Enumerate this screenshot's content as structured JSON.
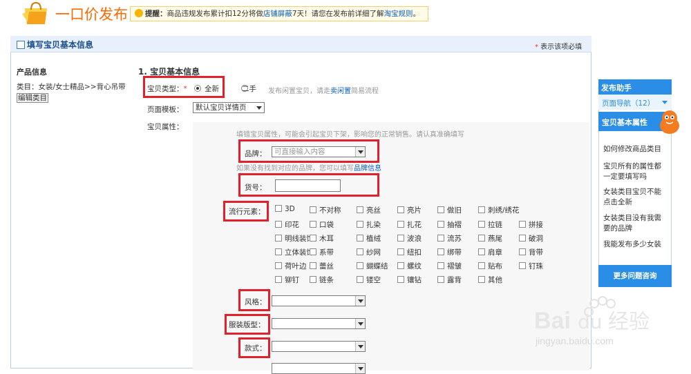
{
  "header": {
    "title": "一口价发布",
    "notice_label": "提醒：",
    "notice_text_1": "商品违规发布累计扣12分将做",
    "notice_link_1": "店铺屏蔽",
    "notice_text_2": "7天！请您在发布前详细了解",
    "notice_link_2": "淘宝规则",
    "notice_end": "。"
  },
  "panel": {
    "title": "填写宝贝基本信息",
    "required_star": "*",
    "required_note": " 表示该项必填"
  },
  "left": {
    "heading": "产品信息",
    "category": "类目：女装/女士精品>>背心吊带",
    "edit_button": "编辑类目"
  },
  "form": {
    "section_heading": "1. 宝贝基本信息",
    "type_label": "宝贝类型：",
    "type_star": "*",
    "type_option_new": "全新",
    "type_option_used": "二手",
    "type_hint": "发布闲置宝贝，请走",
    "type_hint_link": "卖闲置",
    "type_hint_end": "简易流程",
    "template_label": "页面模板：",
    "template_value": "默认宝贝详情页",
    "props_label": "宝贝属性：",
    "props_hint": "填错宝贝属性，可能会引起宝贝下架，影响您的正常销售。请认真准确填写",
    "brand_label": "品牌：",
    "brand_placeholder": "可直接输入内容",
    "brand_hint": "如果没有找到对应的品牌，您可以填写",
    "brand_hint_link": "品牌信息",
    "model_label": "货号：",
    "elements_label": "流行元素：",
    "elements": [
      [
        "3D",
        "不对称",
        "亮丝",
        "亮片",
        "做旧",
        "刺绣/绣花"
      ],
      [
        "印花",
        "口袋",
        "扎染",
        "扎花",
        "抽褶",
        "拉链",
        "拼接"
      ],
      [
        "明线装饰",
        "木耳",
        "植绒",
        "波浪",
        "流苏",
        "燕尾",
        "破洞"
      ],
      [
        "立体装饰",
        "系带",
        "纱网",
        "纽扣",
        "绑带",
        "肩章",
        "背带"
      ],
      [
        "荷叶边",
        "蕾丝",
        "蝴蝶结",
        "螺纹",
        "褶皱",
        "贴布",
        "钉珠"
      ],
      [
        "铆钉",
        "链条",
        "镂空",
        "镶钻",
        "露背",
        "其他"
      ]
    ],
    "style_label": "风格：",
    "fit_label": "服装版型：",
    "cut_label": "款式："
  },
  "helper": {
    "title": "发布助手",
    "nav": "页面导航（12）",
    "section": "宝贝基本属性",
    "items": [
      "如何修改商品类目",
      "宝贝所有的属性都一定要填写吗",
      "女装类目宝贝不能点击全新",
      "女装类目没有我需要的品牌",
      "我能发布多少女装"
    ],
    "more_button": "更多问题咨询"
  },
  "watermark": {
    "logo": "Bai 经验",
    "url": "jingyan.baidu.com"
  },
  "colors": {
    "brand_orange": "#ff6a00",
    "accent_blue": "#2a8ee6",
    "highlight_red": "#e0202a",
    "link_blue": "#0a5ec4"
  }
}
